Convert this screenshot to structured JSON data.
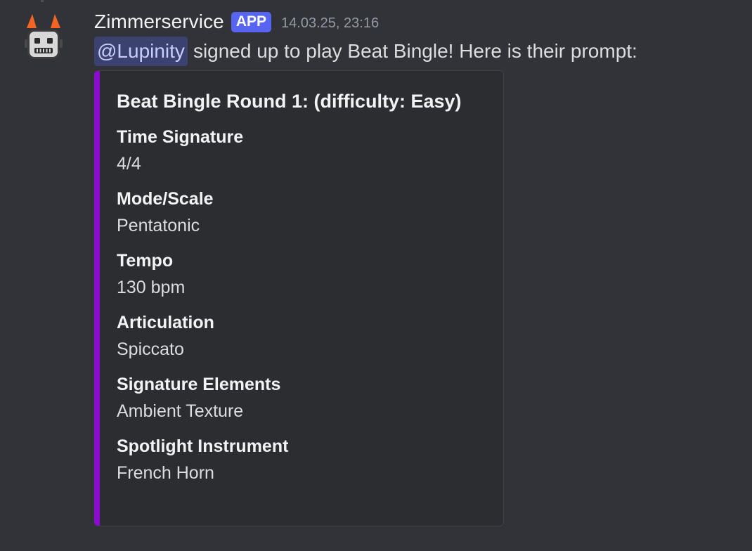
{
  "message": {
    "avatar_icon": "robot-avatar-icon",
    "username": "Zimmerservice",
    "badge": "APP",
    "timestamp": "14.03.25, 23:16",
    "mention": "@Lupinity",
    "text": "signed up to play Beat Bingle! Here is their prompt:"
  },
  "embed": {
    "accent_color": "#8d0ad1",
    "title": "Beat Bingle Round 1: (difficulty: Easy)",
    "fields": [
      {
        "name": "Time Signature",
        "value": "4/4"
      },
      {
        "name": "Mode/Scale",
        "value": "Pentatonic"
      },
      {
        "name": "Tempo",
        "value": "130 bpm"
      },
      {
        "name": "Articulation",
        "value": "Spiccato"
      },
      {
        "name": "Signature Elements",
        "value": "Ambient Texture"
      },
      {
        "name": "Spotlight Instrument",
        "value": "French Horn"
      }
    ]
  },
  "colors": {
    "background": "#313338",
    "embed_background": "#2b2d31",
    "badge": "#5865f2",
    "mention_background": "#3c4270"
  }
}
